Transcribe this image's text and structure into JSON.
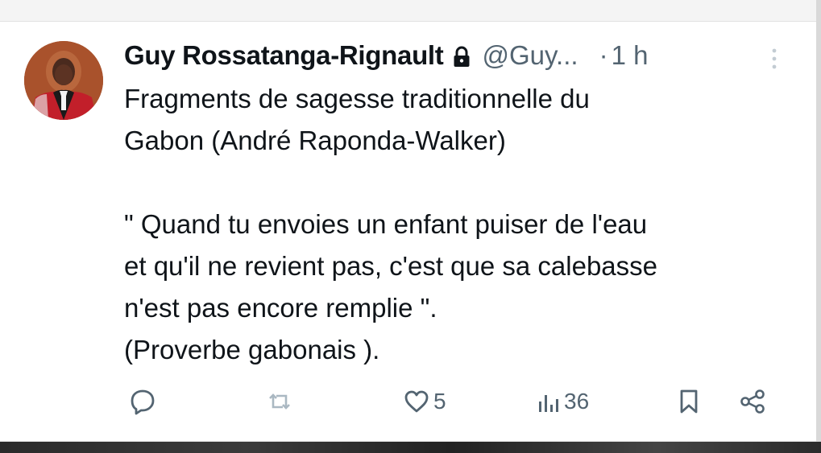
{
  "tweet": {
    "author": {
      "display_name": "Guy Rossatanga-Rignault",
      "handle": "@Guy...",
      "separator": "·",
      "time": "1 h"
    },
    "body": {
      "line_1": "Fragments de sagesse traditionnelle du\nGabon (André Raponda-Walker)",
      "line_2": "\"  Quand tu envoies un enfant puiser de l'eau\net qu'il ne revient pas, c'est que sa calebasse\nn'est pas encore remplie \".\n(Proverbe gabonais )."
    },
    "actions": {
      "reply": {
        "icon": "reply-icon",
        "count": ""
      },
      "repost": {
        "icon": "repost-icon",
        "count": ""
      },
      "like": {
        "icon": "heart-icon",
        "count": "5"
      },
      "views": {
        "icon": "views-icon",
        "count": "36"
      },
      "bookmark": {
        "icon": "bookmark-icon"
      },
      "share": {
        "icon": "share-icon"
      }
    }
  },
  "colors": {
    "text": "#0f1419",
    "secondary": "#536471",
    "repost_disabled": "#aab8c2",
    "background": "#ffffff"
  }
}
